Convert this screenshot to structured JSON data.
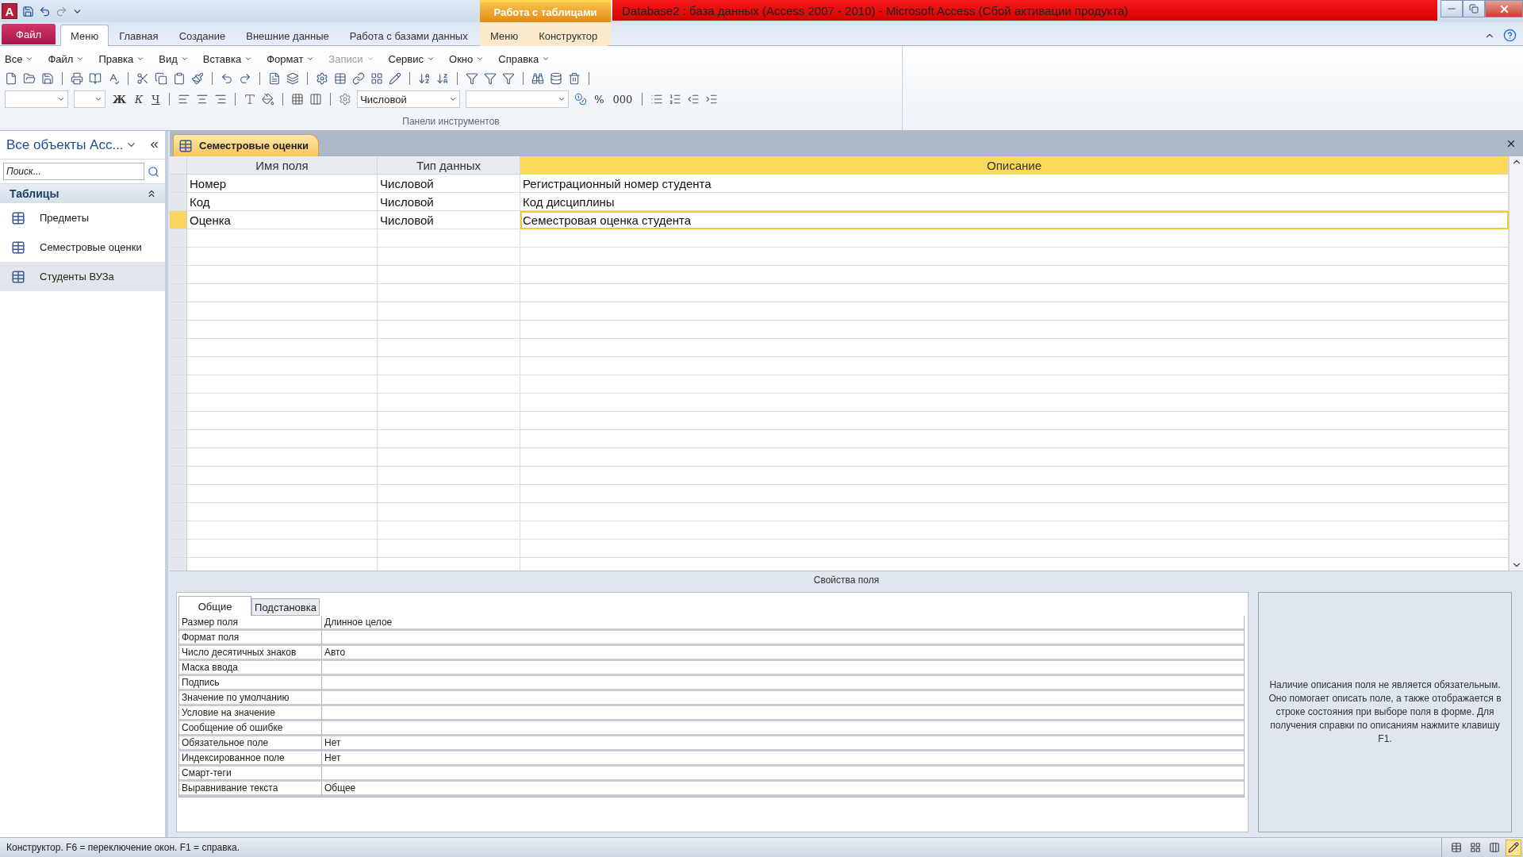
{
  "window": {
    "app_logo": "A",
    "title": "Database2 : база данных (Access 2007 - 2010)  -  Microsoft Access (Сбой активации продукта)"
  },
  "ribbon": {
    "file_tab": "Файл",
    "tabs": [
      {
        "label": "Меню",
        "selected": true
      },
      {
        "label": "Главная",
        "selected": false
      },
      {
        "label": "Создание",
        "selected": false
      },
      {
        "label": "Внешние данные",
        "selected": false
      },
      {
        "label": "Работа с базами данных",
        "selected": false
      }
    ],
    "context_group": {
      "title": "Работа с таблицами",
      "tabs": [
        {
          "label": "Меню",
          "selected": false
        },
        {
          "label": "Конструктор",
          "selected": false
        }
      ]
    },
    "menus": [
      {
        "label": "Все",
        "disabled": false
      },
      {
        "label": "Файл",
        "disabled": false
      },
      {
        "label": "Правка",
        "disabled": false
      },
      {
        "label": "Вид",
        "disabled": false
      },
      {
        "label": "Вставка",
        "disabled": false
      },
      {
        "label": "Формат",
        "disabled": false
      },
      {
        "label": "Записи",
        "disabled": true
      },
      {
        "label": "Сервис",
        "disabled": false
      },
      {
        "label": "Окно",
        "disabled": false
      },
      {
        "label": "Справка",
        "disabled": false
      }
    ],
    "format_buttons": [
      "Ж",
      "К",
      "Ч"
    ],
    "number_format": "Числовой",
    "number_buttons": [
      "%",
      "000"
    ],
    "group_label": "Панели инструментов"
  },
  "nav_pane": {
    "title": "Все объекты Acc...",
    "search_placeholder": "Поиск...",
    "group": "Таблицы",
    "items": [
      {
        "label": "Предметы",
        "selected": false
      },
      {
        "label": "Семестровые оценки",
        "selected": false
      },
      {
        "label": "Студенты ВУЗа",
        "selected": true
      }
    ]
  },
  "document": {
    "tab": "Семестровые оценки",
    "columns": [
      {
        "label": "Имя поля",
        "selected": false
      },
      {
        "label": "Тип данных",
        "selected": false
      },
      {
        "label": "Описание",
        "selected": true
      }
    ],
    "rows": [
      {
        "name": "Номер",
        "type": "Числовой",
        "description": "Регистрационный номер студента",
        "selected": false
      },
      {
        "name": "Код",
        "type": "Числовой",
        "description": "Код дисциплины",
        "selected": false
      },
      {
        "name": "Оценка",
        "type": "Числовой",
        "description": "Семестровая оценка студента",
        "selected": true
      }
    ]
  },
  "field_properties": {
    "title": "Свойства поля",
    "tabs": [
      {
        "label": "Общие",
        "selected": true
      },
      {
        "label": "Подстановка",
        "selected": false
      }
    ],
    "properties": [
      {
        "label": "Размер поля",
        "value": "Длинное целое"
      },
      {
        "label": "Формат поля"
      },
      {
        "label": "Число десятичных знаков",
        "value": "Авто"
      },
      {
        "label": "Маска ввода"
      },
      {
        "label": "Подпись"
      },
      {
        "label": "Значение по умолчанию"
      },
      {
        "label": "Условие на значение"
      },
      {
        "label": "Сообщение об ошибке"
      },
      {
        "label": "Обязательное поле",
        "value": "Нет"
      },
      {
        "label": "Индексированное поле",
        "value": "Нет"
      },
      {
        "label": "Смарт-теги"
      },
      {
        "label": "Выравнивание текста",
        "value": "Общее"
      }
    ],
    "help": "Наличие описания поля не является обязательным. Оно помогает описать поле, а также отображается в строке состояния при выборе поля в форме. Для получения справки по описаниям нажмите клавишу F1."
  },
  "status_bar": {
    "text": "Конструктор.  F6 = переключение окон.  F1 = справка.",
    "views": [
      {
        "selected": false
      },
      {
        "selected": false
      },
      {
        "selected": false
      },
      {
        "selected": true
      }
    ]
  }
}
